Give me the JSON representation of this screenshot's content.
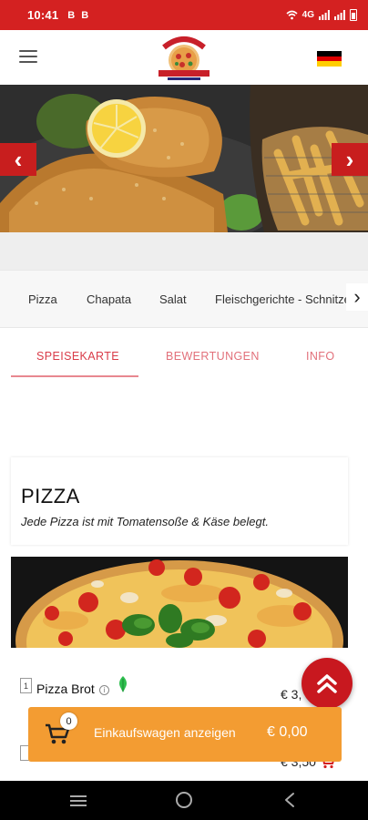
{
  "status_bar": {
    "time": "10:41",
    "notif_icons": [
      "B",
      "B"
    ],
    "network": "4G"
  },
  "header": {
    "menu_icon": "hamburger-icon",
    "logo_alt": "Pizzeria Margherita logo",
    "language_flag": "germany-flag-icon"
  },
  "banner": {
    "prev_icon": "chevron-left-icon",
    "next_icon": "chevron-right-icon",
    "prev_label": "‹",
    "next_label": "›"
  },
  "categories": {
    "items": [
      "Pizza",
      "Chapata",
      "Salat",
      "Fleischgerichte - Schnitzel"
    ],
    "more_label": "›"
  },
  "tabs": {
    "items": [
      "SPEISEKARTE",
      "BEWERTUNGEN",
      "INFO"
    ],
    "active": "SPEISEKARTE"
  },
  "section": {
    "title": "PIZZA",
    "description": "Jede Pizza ist mit Tomatensoße & Käse belegt."
  },
  "items": [
    {
      "number": "1",
      "name": "Pizza Brot",
      "price": "€ 3,",
      "vegetarian": true
    },
    {
      "number": "",
      "name": "",
      "price": "€ 3,50"
    }
  ],
  "cart": {
    "count": "0",
    "label": "Einkaufswagen anzeigen",
    "total": "€ 0,00"
  },
  "colors": {
    "brand_red": "#d42121",
    "cart_orange": "#f39c32",
    "tab_pink": "#e2707a"
  }
}
